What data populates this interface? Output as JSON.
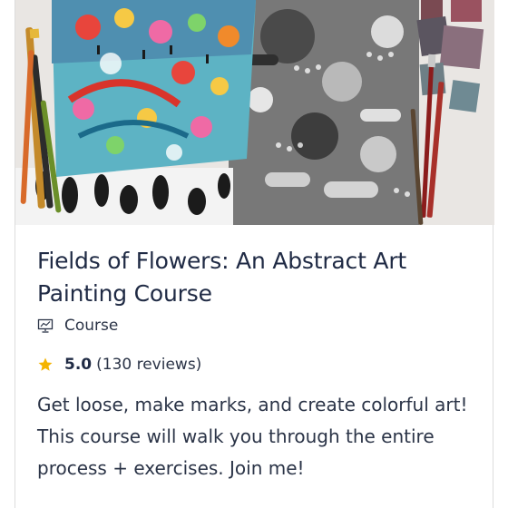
{
  "course": {
    "image_alt": "Abstract colorful and black-and-white painted canvases with paintbrushes and color swatches",
    "title": "Fields of Flowers: An Abstract Art Painting Course",
    "type_icon": "presentation-board-icon",
    "type_label": "Course",
    "rating_icon": "star-icon",
    "rating_value": "5.0",
    "review_count": "(130 reviews)",
    "description": "Get loose, make marks, and create colorful art! This course will walk you through the entire process + exercises. Join me!"
  },
  "colors": {
    "title": "#1f2a44",
    "text": "#2b3447",
    "star": "#f4b400",
    "border": "#dcdcdc"
  }
}
